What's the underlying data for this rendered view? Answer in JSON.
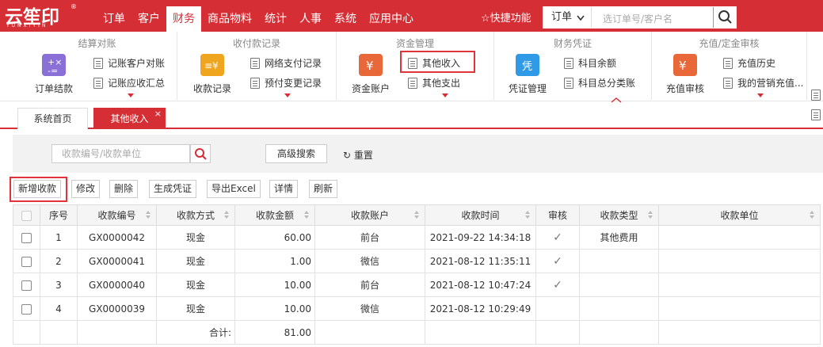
{
  "logo": {
    "text": "云笙印",
    "sub": "YUNXIYIN",
    "reg": "®"
  },
  "nav": {
    "items": [
      "订单",
      "客户",
      "财务",
      "商品物料",
      "统计",
      "人事",
      "系统",
      "应用中心"
    ],
    "active": "财务"
  },
  "quick": {
    "label": "快捷功能"
  },
  "topsearch": {
    "select": "订单",
    "placeholder": "选订单号/客户名"
  },
  "ribbon": {
    "groups": {
      "settle": {
        "title": "结算对账",
        "big": "订单结款",
        "items": [
          "记账客户对账",
          "记账应收汇总"
        ]
      },
      "receipt": {
        "title": "收付款记录",
        "big": "收款记录",
        "items": [
          "网络支付记录",
          "预付变更记录"
        ]
      },
      "fund": {
        "title": "资金管理",
        "big": "资金账户",
        "items": [
          "其他收入",
          "其他支出"
        ]
      },
      "voucher": {
        "title": "财务凭证",
        "big": "凭证管理",
        "items": [
          "科目余额",
          "科目总分类账"
        ]
      },
      "recharge": {
        "title": "充值/定金审核",
        "big": "充值审核",
        "items": [
          "充值历史",
          "我的营销充值..."
        ]
      }
    }
  },
  "tabs": {
    "home": "系统首页",
    "current": "其他收入",
    "close": "×"
  },
  "filter": {
    "placeholder": "收款编号/收款单位",
    "advanced": "高级搜索",
    "reset": "重置"
  },
  "toolbar": {
    "add": "新增收款",
    "edit": "修改",
    "delete": "删除",
    "voucher": "生成凭证",
    "export": "导出Excel",
    "detail": "详情",
    "refresh": "刷新"
  },
  "table": {
    "headers": [
      "序号",
      "收款编号",
      "收款方式",
      "收款金额",
      "收款账户",
      "收款时间",
      "审核",
      "收款类型",
      "收款单位"
    ],
    "rows": [
      {
        "no": "1",
        "code": "GX0000042",
        "method": "现金",
        "amount": "60.00",
        "account": "前台",
        "time": "2021-09-22 14:34:18",
        "audited": "✓",
        "type": "其他费用",
        "unit": ""
      },
      {
        "no": "2",
        "code": "GX0000041",
        "method": "现金",
        "amount": "1.00",
        "account": "微信",
        "time": "2021-08-12 11:35:11",
        "audited": "✓",
        "type": "",
        "unit": ""
      },
      {
        "no": "3",
        "code": "GX0000040",
        "method": "现金",
        "amount": "10.00",
        "account": "前台",
        "time": "2021-08-12 10:47:24",
        "audited": "✓",
        "type": "",
        "unit": ""
      },
      {
        "no": "4",
        "code": "GX0000039",
        "method": "现金",
        "amount": "10.00",
        "account": "微信",
        "time": "2021-08-12 10:29:49",
        "audited": "",
        "type": "",
        "unit": ""
      }
    ],
    "total_label": "合计:",
    "total_value": "81.00"
  }
}
